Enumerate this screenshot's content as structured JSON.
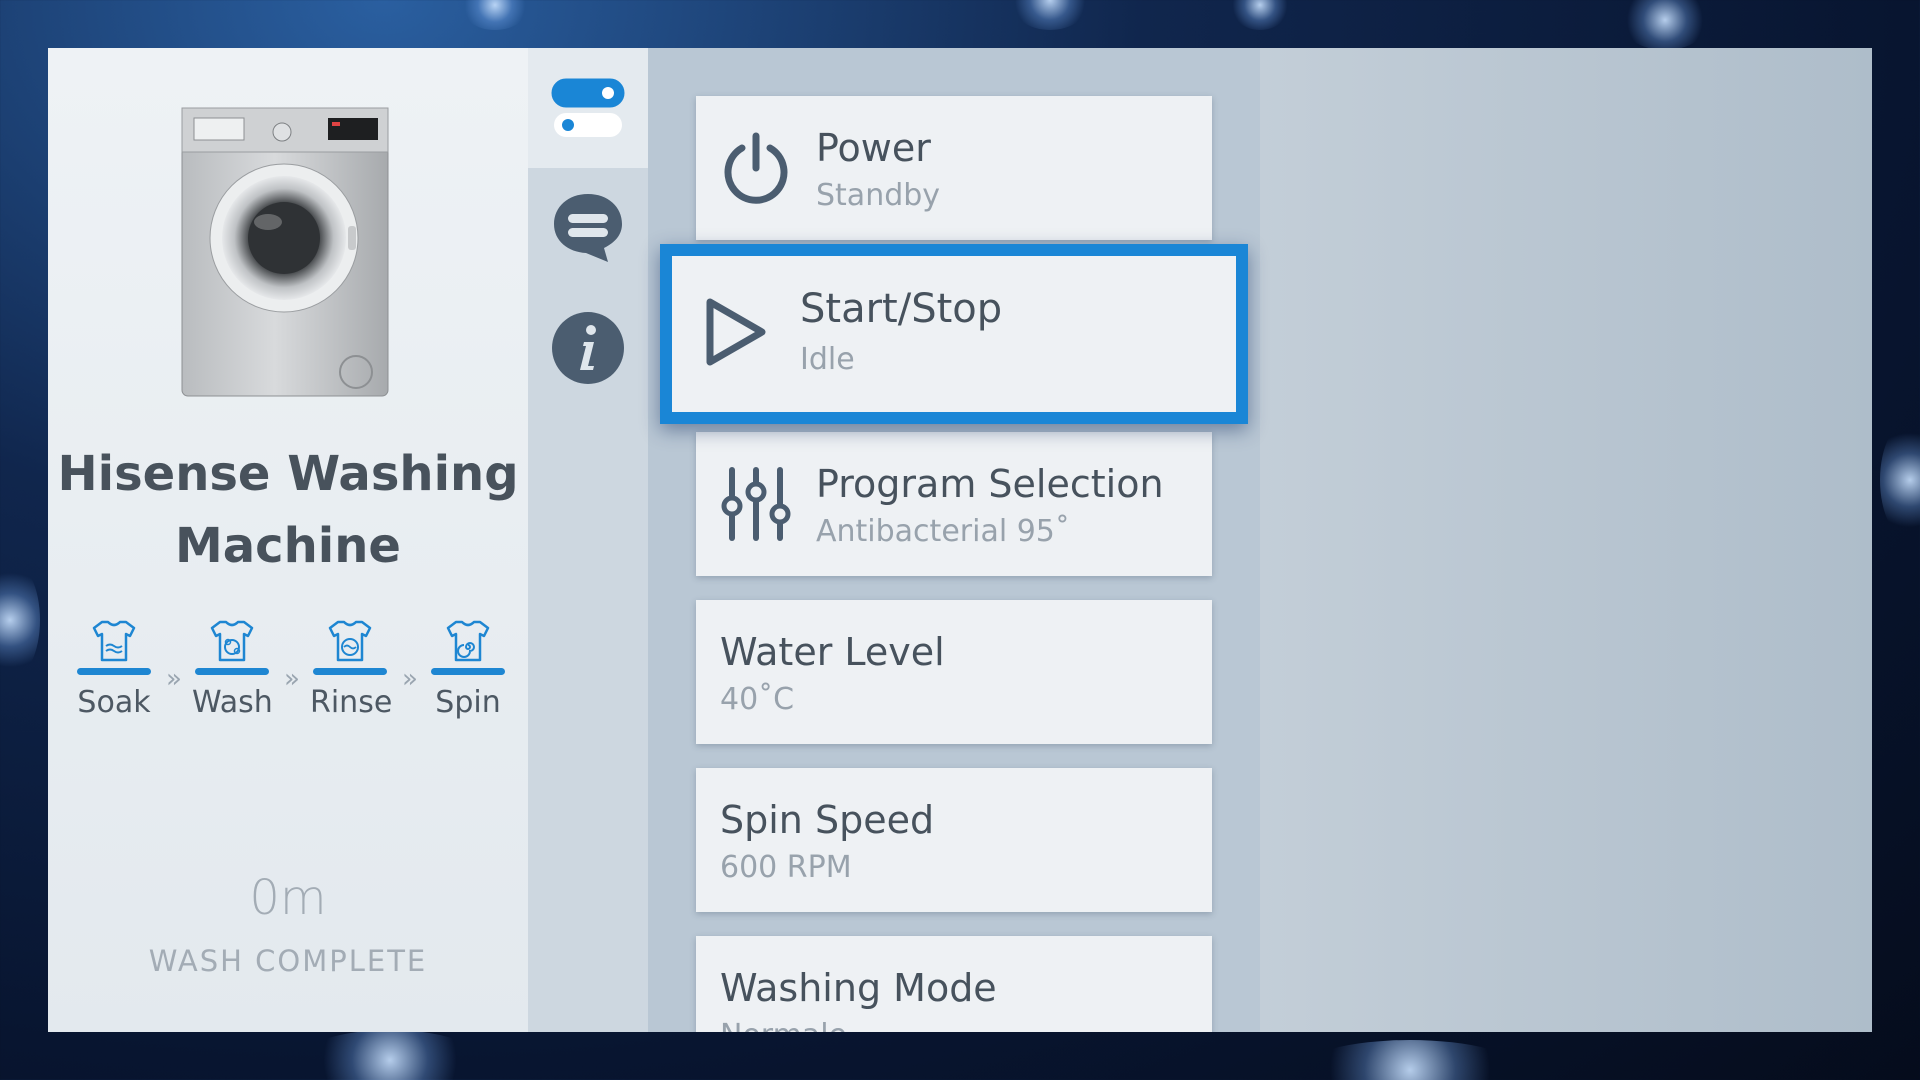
{
  "device": {
    "name": "Hisense Washing Machine",
    "image_icon": "washing-machine-image"
  },
  "stages": [
    {
      "label": "Soak",
      "icon": "shirt-soak-icon"
    },
    {
      "label": "Wash",
      "icon": "shirt-wash-icon"
    },
    {
      "label": "Rinse",
      "icon": "shirt-rinse-icon"
    },
    {
      "label": "Spin",
      "icon": "shirt-spin-icon"
    }
  ],
  "stage_separator": "»",
  "timer": {
    "value": "0m",
    "status": "WASH COMPLETE"
  },
  "nav": [
    {
      "icon": "toggle-settings-icon",
      "active": true
    },
    {
      "icon": "chat-icon",
      "active": false
    },
    {
      "icon": "info-icon",
      "active": false
    }
  ],
  "controls": [
    {
      "title": "Power",
      "value": "Standby",
      "icon": "power-icon"
    },
    {
      "title": "Start/Stop",
      "value": "Idle",
      "icon": "play-icon",
      "focused": true
    },
    {
      "title": "Program Selection",
      "value": "Antibacterial 95˚",
      "icon": "sliders-icon"
    },
    {
      "title": "Water Level",
      "value": "40˚C"
    },
    {
      "title": "Spin Speed",
      "value": "600 RPM"
    },
    {
      "title": "Washing Mode",
      "value": "Normale"
    }
  ],
  "colors": {
    "accent": "#1a86d6",
    "icon": "#4b5d70",
    "text_primary": "#47525d",
    "text_secondary": "#98a2ac"
  }
}
